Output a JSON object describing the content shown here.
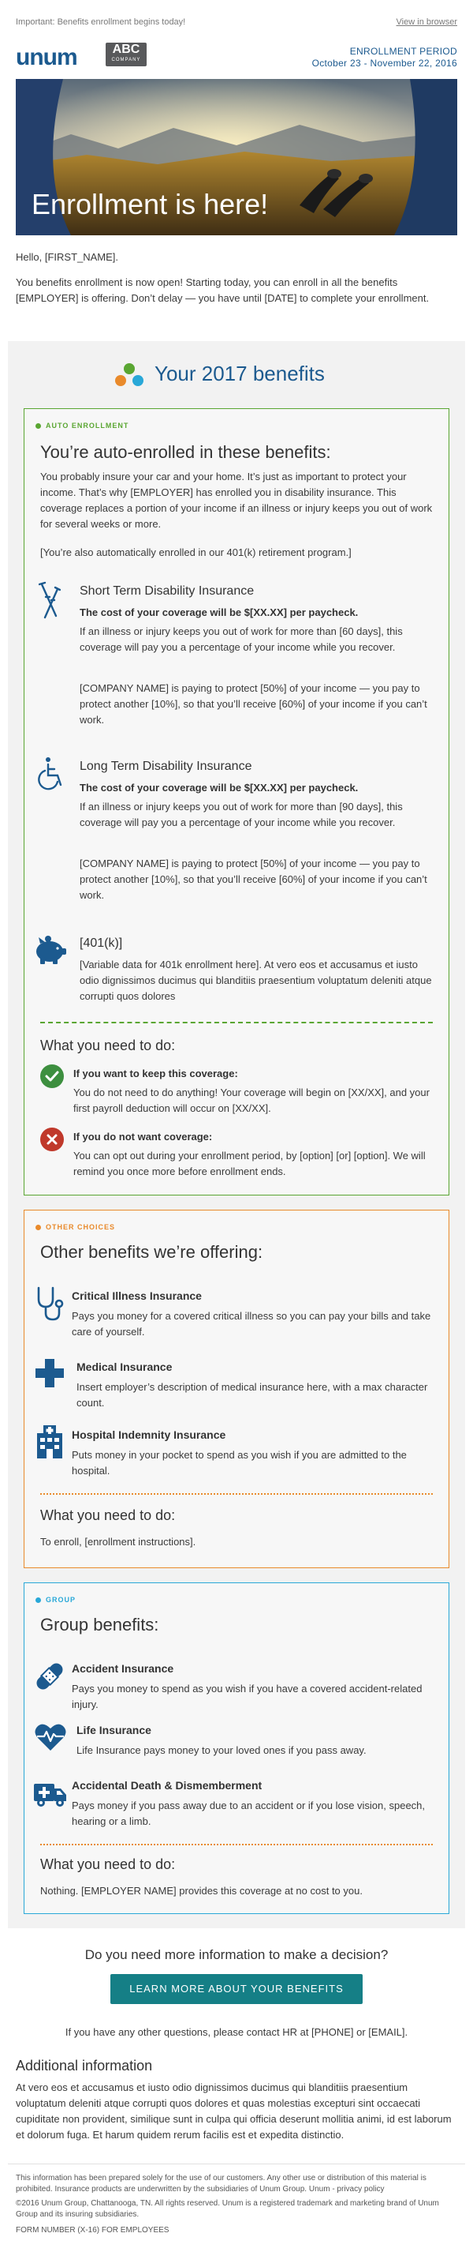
{
  "preheader": "Important: Benefits enrollment begins today!",
  "view_in_browser": "View in browser",
  "logo": {
    "unum": "unum",
    "abc_big": "ABC",
    "abc_small": "COMPANY"
  },
  "period": {
    "label": "ENROLLMENT PERIOD",
    "dates": "October 23 - November 22, 2016"
  },
  "hero_title": "Enrollment is here!",
  "greeting": "Hello, [FIRST_NAME].",
  "intro": "You benefits enrollment is now open!  Starting today, you can enroll in all the benefits [EMPLOYER] is offering. Don’t delay — you have until [DATE] to complete your enrollment.",
  "benefits_title": "Your 2017 benefits",
  "auto": {
    "tag": "AUTO ENROLLMENT",
    "heading": "You’re auto-enrolled in these benefits:",
    "intro": "You probably insure your car and your home. It’s just as important to protect your income. That’s why [EMPLOYER] has enrolled you in disability insurance.  This coverage replaces a portion of your income if an illness or injury keeps you out of work for several weeks or more.",
    "note": "[You’re also automatically enrolled in our 401(k) retirement program.]",
    "std": {
      "title": "Short Term Disability Insurance",
      "cost": "The cost of your coverage will be $[XX.XX] per paycheck.",
      "p1": "If an illness or injury keeps you out of work for more than [60 days], this coverage will pay you a percentage of your income while you recover.",
      "p2": "[COMPANY NAME] is paying to protect [50%] of your income — you pay to protect another [10%], so that you’ll receive [60%] of your income if you can’t work."
    },
    "ltd": {
      "title": "Long Term Disability Insurance",
      "cost": "The cost of your coverage will be $[XX.XX] per paycheck.",
      "p1": "If an illness or injury keeps you out of work for more than [90 days], this coverage will pay you a percentage of your income while you recover.",
      "p2": "[COMPANY NAME] is paying to protect [50%] of your income — you pay to protect another [10%], so that you’ll receive [60%] of your income if you can’t work."
    },
    "k401": {
      "title": "[401(k)]",
      "p1": "[Variable data for 401k enrollment here]. At vero eos et accusamus et iusto odio dignissimos ducimus qui blanditiis praesentium voluptatum deleniti atque corrupti quos dolores"
    },
    "need_heading": "What you need to do:",
    "keep_title": "If you want to keep this coverage:",
    "keep_text": "You do not need to do anything! Your coverage will begin on [XX/XX], and your first payroll deduction will occur on [XX/XX].",
    "notwant_title": "If you do not want coverage:",
    "notwant_text": "You can opt out during your enrollment period, by [option] [or] [option]. We will remind you once more before enrollment ends."
  },
  "other": {
    "tag": "OTHER CHOICES",
    "heading": "Other benefits we’re offering:",
    "items": [
      {
        "title": "Critical Illness Insurance",
        "text": "Pays you money for a covered critical illness so you can pay your bills and take care of yourself."
      },
      {
        "title": "Medical Insurance",
        "text": "Insert employer’s description of medical insurance here, with a max character count."
      },
      {
        "title": "Hospital Indemnity Insurance",
        "text": "Puts money in your pocket to spend as you wish if you are admitted to the hospital."
      }
    ],
    "need_heading": "What you need to do:",
    "need_text": "To enroll, [enrollment instructions]."
  },
  "group": {
    "tag": "GROUP",
    "heading": "Group benefits:",
    "items": [
      {
        "title": "Accident Insurance",
        "text": "Pays you money to spend as you wish if you have a covered accident-related injury."
      },
      {
        "title": "Life Insurance",
        "text": "Life Insurance pays money to your loved ones if you pass away."
      },
      {
        "title": "Accidental Death & Dismemberment",
        "text": "Pays money if you pass away due to an accident or if you lose vision, speech, hearing or a limb."
      }
    ],
    "need_heading": "What you need to do:",
    "need_text": "Nothing.  [EMPLOYER NAME] provides this coverage at no cost to you."
  },
  "more_info": {
    "heading": "Do you need more information to make a decision?",
    "button": "LEARN MORE ABOUT YOUR BENEFITS",
    "contact": "If you have any other questions, please contact HR at [PHONE] or [EMAIL]."
  },
  "additional": {
    "heading": "Additional information",
    "text": "At vero eos et accusamus et iusto odio dignissimos ducimus qui blanditiis praesentium voluptatum deleniti atque corrupti quos dolores et quas molestias excepturi sint occaecati cupiditate non provident, similique sunt in culpa qui officia deserunt mollitia animi, id est laborum et dolorum fuga. Et harum quidem rerum facilis est et expedita distinctio."
  },
  "footer": {
    "disclaimer": "This information has been prepared solely for the use of our customers. Any other use or distribution of this material is prohibited. Insurance products are underwritten by the subsidiaries of Unum Group. Unum - privacy policy",
    "copyright": "©2016 Unum Group, Chattanooga, TN. All rights reserved. Unum is a registered trademark and marketing brand of Unum Group and its insuring subsidiaries.",
    "form": "FORM NUMBER (X-16) FOR EMPLOYEES"
  },
  "colors": {
    "brand_blue": "#1c5a8f",
    "green": "#5aa632",
    "orange": "#e98a2b",
    "cyan": "#29a8d8",
    "button_teal": "#157f86",
    "red": "#c0392b"
  }
}
